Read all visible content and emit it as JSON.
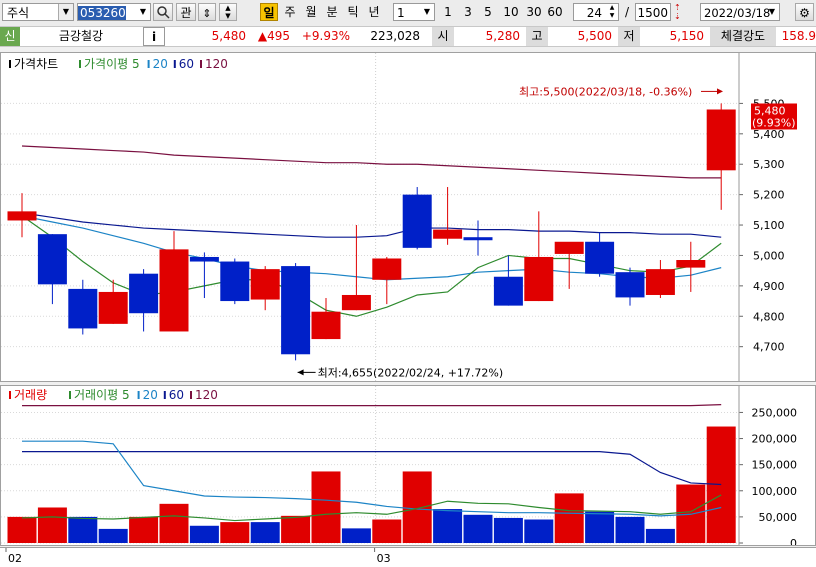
{
  "toolbar": {
    "market": "주식",
    "code": "053260",
    "btn_gwan": "관",
    "periods": [
      "일",
      "주",
      "월",
      "분",
      "틱",
      "년"
    ],
    "unit_value": "1",
    "quick_units": [
      "1",
      "3",
      "5",
      "10",
      "30",
      "60"
    ],
    "view_count": "24",
    "total_count": "1500",
    "date": "2022/03/18"
  },
  "info": {
    "badge": "신",
    "stock_name": "금강철강",
    "info_button": "i",
    "price": "5,480",
    "change": "▲495",
    "change_pct": "+9.93%",
    "volume": "223,028",
    "open_label": "시",
    "open": "5,280",
    "high_label": "고",
    "high": "5,500",
    "low_label": "저",
    "low": "5,150",
    "strength_label": "체결강도",
    "strength": "158.9"
  },
  "colors": {
    "up": "#e00000",
    "down": "#0020c8",
    "ma5": "#2e8b2e",
    "ma20": "#1c84c6",
    "ma60": "#0a1890",
    "ma120": "#7a1040"
  },
  "chart_data": [
    {
      "type": "candlestick",
      "title": "가격차트",
      "legend": [
        {
          "name": "가격이평",
          "period": "5",
          "color": "#2e8b2e"
        },
        {
          "name": "",
          "period": "20",
          "color": "#1c84c6"
        },
        {
          "name": "",
          "period": "60",
          "color": "#0a1890"
        },
        {
          "name": "",
          "period": "120",
          "color": "#7a1040"
        }
      ],
      "y_ticks": [
        "5,500",
        "5,400",
        "5,300",
        "5,200",
        "5,100",
        "5,000",
        "4,900",
        "4,800",
        "4,700"
      ],
      "ylim": [
        4620,
        5600
      ],
      "candles": [
        {
          "o": 5115,
          "c": 5145,
          "h": 5205,
          "l": 5060
        },
        {
          "o": 5070,
          "c": 4905,
          "h": 5070,
          "l": 4840
        },
        {
          "o": 4890,
          "c": 4760,
          "h": 4920,
          "l": 4740
        },
        {
          "o": 4775,
          "c": 4880,
          "h": 4920,
          "l": 4775
        },
        {
          "o": 4940,
          "c": 4810,
          "h": 4955,
          "l": 4750
        },
        {
          "o": 4750,
          "c": 5020,
          "h": 5080,
          "l": 4750
        },
        {
          "o": 4995,
          "c": 4980,
          "h": 5010,
          "l": 4860
        },
        {
          "o": 4980,
          "c": 4850,
          "h": 4990,
          "l": 4840
        },
        {
          "o": 4855,
          "c": 4955,
          "h": 4965,
          "l": 4820
        },
        {
          "o": 4965,
          "c": 4675,
          "h": 4975,
          "l": 4655
        },
        {
          "o": 4725,
          "c": 4815,
          "h": 4860,
          "l": 4725
        },
        {
          "o": 4820,
          "c": 4870,
          "h": 5100,
          "l": 4820
        },
        {
          "o": 4920,
          "c": 4990,
          "h": 4995,
          "l": 4840
        },
        {
          "o": 5200,
          "c": 5025,
          "h": 5225,
          "l": 5020
        },
        {
          "o": 5055,
          "c": 5085,
          "h": 5225,
          "l": 5035
        },
        {
          "o": 5060,
          "c": 5050,
          "h": 5115,
          "l": 5000
        },
        {
          "o": 4930,
          "c": 4835,
          "h": 5000,
          "l": 4835
        },
        {
          "o": 4850,
          "c": 4995,
          "h": 5145,
          "l": 4850
        },
        {
          "o": 5005,
          "c": 5045,
          "h": 5040,
          "l": 4890
        },
        {
          "o": 5045,
          "c": 4940,
          "h": 5075,
          "l": 4930
        },
        {
          "o": 4945,
          "c": 4862,
          "h": 4960,
          "l": 4835
        },
        {
          "o": 4870,
          "c": 4955,
          "h": 4985,
          "l": 4860
        },
        {
          "o": 4960,
          "c": 4985,
          "h": 5045,
          "l": 4880
        },
        {
          "o": 5280,
          "c": 5480,
          "h": 5500,
          "l": 5150
        }
      ],
      "ma5": [
        5130,
        5060,
        4980,
        4910,
        4870,
        4880,
        4900,
        4920,
        4920,
        4880,
        4820,
        4800,
        4830,
        4870,
        4880,
        4960,
        5000,
        4990,
        4990,
        4970,
        4950,
        4945,
        4965,
        5040
      ],
      "ma20": [
        5130,
        5110,
        5090,
        5065,
        5040,
        5010,
        4990,
        4965,
        4950,
        4945,
        4940,
        4930,
        4920,
        4925,
        4930,
        4945,
        4950,
        4955,
        4945,
        4940,
        4930,
        4925,
        4935,
        4960
      ],
      "ma60": [
        5140,
        5125,
        5110,
        5100,
        5090,
        5085,
        5080,
        5075,
        5070,
        5065,
        5060,
        5060,
        5065,
        5090,
        5090,
        5085,
        5085,
        5080,
        5080,
        5075,
        5075,
        5070,
        5070,
        5060
      ],
      "ma120": [
        5360,
        5355,
        5350,
        5345,
        5340,
        5330,
        5325,
        5320,
        5315,
        5310,
        5305,
        5305,
        5300,
        5300,
        5295,
        5290,
        5285,
        5280,
        5275,
        5270,
        5265,
        5260,
        5255,
        5255
      ],
      "annotations": {
        "high": "최고:5,500(2022/03/18, -0.36%)",
        "low": "최저:4,655(2022/02/24, +17.72%)",
        "last_price": "5,480",
        "last_pct": "(9.93%)"
      }
    },
    {
      "type": "bar",
      "title": "거래량",
      "legend": [
        {
          "name": "거래이평",
          "period": "5",
          "color": "#2e8b2e"
        },
        {
          "name": "",
          "period": "20",
          "color": "#1c84c6"
        },
        {
          "name": "",
          "period": "60",
          "color": "#0a1890"
        },
        {
          "name": "",
          "period": "120",
          "color": "#7a1040"
        }
      ],
      "y_ticks": [
        "250,000",
        "200,000",
        "150,000",
        "100,000",
        "50,000",
        "0"
      ],
      "ylim": [
        0,
        270000
      ],
      "values": [
        50000,
        68000,
        50000,
        27000,
        50000,
        75000,
        33000,
        40000,
        40000,
        52000,
        137000,
        28000,
        45000,
        137000,
        65000,
        54000,
        48000,
        45000,
        95000,
        60000,
        50000,
        27000,
        112000,
        223028
      ],
      "up": [
        true,
        true,
        false,
        false,
        true,
        true,
        false,
        true,
        false,
        true,
        true,
        false,
        true,
        true,
        false,
        false,
        false,
        false,
        true,
        false,
        false,
        false,
        true,
        true
      ],
      "ma5": [
        48000,
        50000,
        47000,
        46000,
        49000,
        52000,
        48000,
        43000,
        46000,
        49000,
        55000,
        58000,
        55000,
        66000,
        80000,
        76000,
        75000,
        68000,
        62000,
        61000,
        60000,
        55000,
        60000,
        92000
      ],
      "ma20": [
        195000,
        195000,
        195000,
        190000,
        110000,
        100000,
        90000,
        88000,
        87000,
        85000,
        82000,
        78000,
        70000,
        65000,
        62000,
        60000,
        58000,
        58000,
        57000,
        56000,
        55000,
        52000,
        55000,
        68000
      ],
      "ma60": [
        175000,
        175000,
        175000,
        175000,
        175000,
        175000,
        175000,
        175000,
        175000,
        175000,
        175000,
        175000,
        175000,
        175000,
        175000,
        175000,
        175000,
        175000,
        175000,
        175000,
        170000,
        135000,
        115000,
        112000
      ],
      "ma120": [
        263000,
        263000,
        263000,
        263000,
        263000,
        263000,
        263000,
        263000,
        263000,
        263000,
        263000,
        263000,
        263000,
        263000,
        263000,
        263000,
        263000,
        263000,
        263000,
        263000,
        263000,
        263000,
        263000,
        265000
      ]
    }
  ],
  "x_axis": {
    "labels": [
      "02",
      "03"
    ],
    "label_index": [
      0,
      12
    ]
  }
}
